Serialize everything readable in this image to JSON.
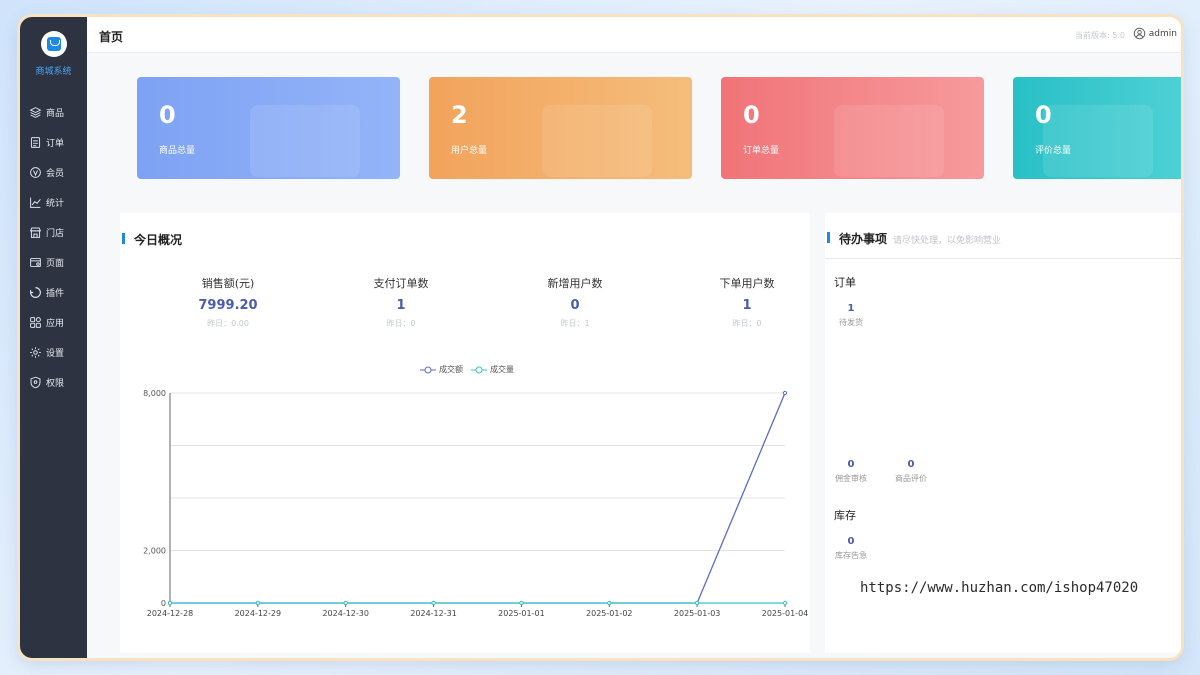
{
  "app": {
    "logo_title": "商城系统",
    "page_title": "首页",
    "version": "当前版本: 5.0",
    "user": "admin"
  },
  "nav": [
    {
      "label": "商品",
      "icon": "layers-icon"
    },
    {
      "label": "订单",
      "icon": "document-icon"
    },
    {
      "label": "会员",
      "icon": "vip-icon"
    },
    {
      "label": "统计",
      "icon": "chart-line-icon"
    },
    {
      "label": "门店",
      "icon": "store-icon"
    },
    {
      "label": "页面",
      "icon": "page-icon"
    },
    {
      "label": "插件",
      "icon": "plugin-icon"
    },
    {
      "label": "应用",
      "icon": "apps-icon"
    },
    {
      "label": "设置",
      "icon": "gear-icon"
    },
    {
      "label": "权限",
      "icon": "shield-icon"
    }
  ],
  "cards": [
    {
      "value": "0",
      "label": "商品总量",
      "color": "#7ea2f4"
    },
    {
      "value": "2",
      "label": "用户总量",
      "color": "#f2a35c"
    },
    {
      "value": "0",
      "label": "订单总量",
      "color": "#f07478"
    },
    {
      "value": "0",
      "label": "评价总量",
      "color": "#28c0c6"
    }
  ],
  "overview": {
    "title": "今日概况",
    "stats": [
      {
        "title": "销售额(元)",
        "value": "7999.20",
        "yesterday": "昨日：0.00"
      },
      {
        "title": "支付订单数",
        "value": "1",
        "yesterday": "昨日：0"
      },
      {
        "title": "新增用户数",
        "value": "0",
        "yesterday": "昨日：1"
      },
      {
        "title": "下单用户数",
        "value": "1",
        "yesterday": "昨日：0"
      }
    ]
  },
  "chart_data": {
    "type": "line",
    "x": [
      "2024-12-28",
      "2024-12-29",
      "2024-12-30",
      "2024-12-31",
      "2025-01-01",
      "2025-01-02",
      "2025-01-03",
      "2025-01-04"
    ],
    "series": [
      {
        "name": "成交额",
        "values": [
          0,
          0,
          0,
          0,
          0,
          0,
          0,
          7999.2
        ],
        "color": "#5b6bc9"
      },
      {
        "name": "成交量",
        "values": [
          0,
          0,
          0,
          0,
          0,
          0,
          0,
          1
        ],
        "color": "#36c4cc"
      }
    ],
    "yticks": [
      "0",
      "2,000",
      "8,000"
    ],
    "ylim": [
      0,
      8000
    ],
    "grid": true,
    "legend": "top-center"
  },
  "todo": {
    "title": "待办事项",
    "subtitle": "请尽快处理，以免影响营业",
    "order_group": "订单",
    "order_items": [
      {
        "value": "1",
        "label": "待发货"
      }
    ],
    "other_items": [
      {
        "value": "0",
        "label": "佣金审核"
      },
      {
        "value": "0",
        "label": "商品评价"
      }
    ],
    "stock_group": "库存",
    "stock_items": [
      {
        "value": "0",
        "label": "库存告急"
      }
    ]
  },
  "watermark": "https://www.huzhan.com/ishop47020"
}
